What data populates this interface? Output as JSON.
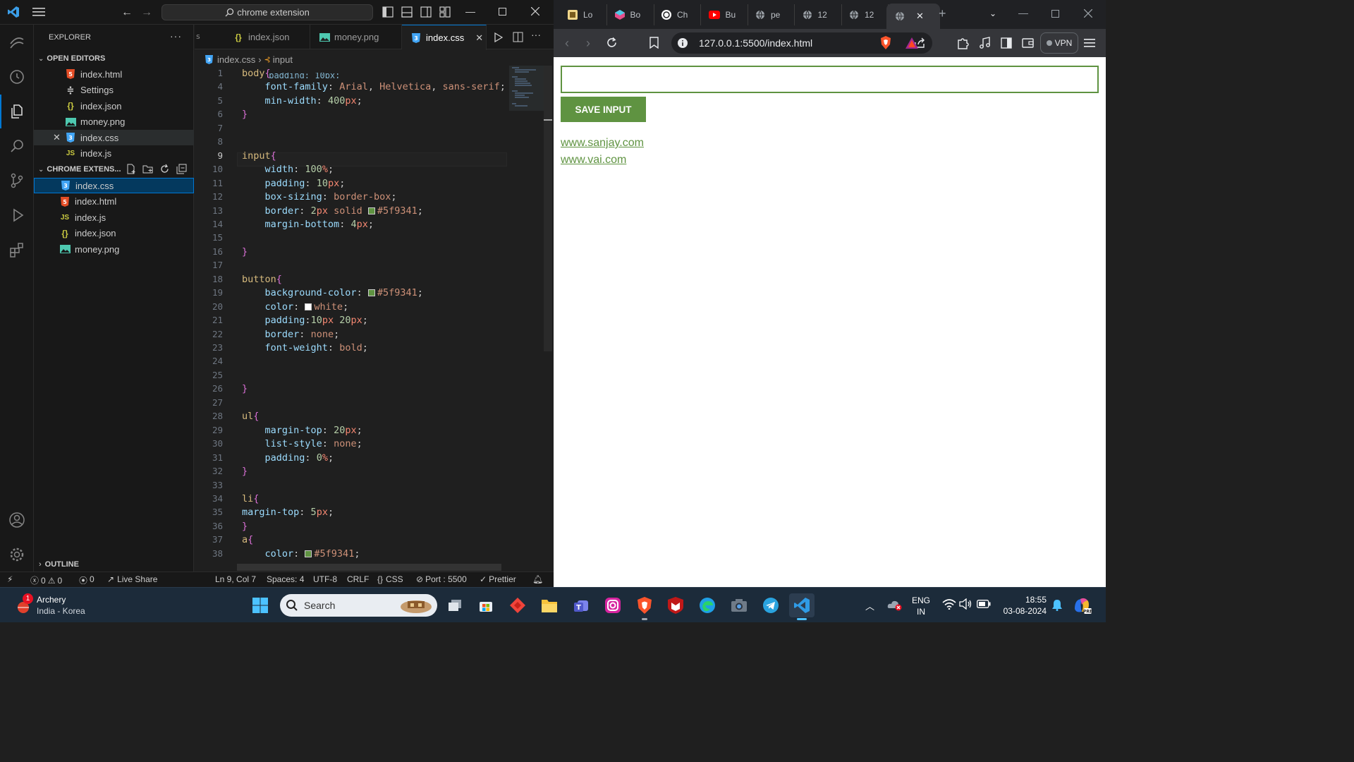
{
  "vscode": {
    "search_text": "chrome extension",
    "explorer_title": "EXPLORER",
    "open_editors_title": "OPEN EDITORS",
    "open_editors": [
      {
        "name": "index.html",
        "icon": "html-icon"
      },
      {
        "name": "Settings",
        "icon": "settings-icon"
      },
      {
        "name": "index.json",
        "icon": "json-icon"
      },
      {
        "name": "money.png",
        "icon": "image-icon"
      },
      {
        "name": "index.css",
        "icon": "css-icon"
      },
      {
        "name": "index.js",
        "icon": "js-icon"
      }
    ],
    "folder_title": "CHROME EXTENS...",
    "folder_files": [
      {
        "name": "index.css",
        "icon": "css-icon"
      },
      {
        "name": "index.html",
        "icon": "html-icon"
      },
      {
        "name": "index.js",
        "icon": "js-icon"
      },
      {
        "name": "index.json",
        "icon": "json-icon"
      },
      {
        "name": "money.png",
        "icon": "image-icon"
      }
    ],
    "outline_title": "OUTLINE",
    "tabs": [
      {
        "label": "index.json"
      },
      {
        "label": "money.png"
      },
      {
        "label": "index.css",
        "active": true
      }
    ],
    "breadcrumb": {
      "file": "index.css",
      "symbol": "input"
    },
    "code_lines": [
      {
        "n": "1",
        "text": "body{"
      },
      {
        "n": "4",
        "text": "    font-family: Arial, Helvetica, sans-serif;"
      },
      {
        "n": "5",
        "text": "    min-width: 400px;"
      },
      {
        "n": "6",
        "text": "}"
      },
      {
        "n": "7",
        "text": ""
      },
      {
        "n": "8",
        "text": ""
      },
      {
        "n": "9",
        "text": "input{"
      },
      {
        "n": "10",
        "text": "    width: 100%;"
      },
      {
        "n": "11",
        "text": "    padding: 10px;"
      },
      {
        "n": "12",
        "text": "    box-sizing: border-box;"
      },
      {
        "n": "13",
        "text": "    border: 2px solid #5f9341;"
      },
      {
        "n": "14",
        "text": "    margin-bottom: 4px;"
      },
      {
        "n": "15",
        "text": ""
      },
      {
        "n": "16",
        "text": "}"
      },
      {
        "n": "17",
        "text": ""
      },
      {
        "n": "18",
        "text": "button{"
      },
      {
        "n": "19",
        "text": "    background-color: #5f9341;"
      },
      {
        "n": "20",
        "text": "    color: white;"
      },
      {
        "n": "21",
        "text": "    padding:10px 20px;"
      },
      {
        "n": "22",
        "text": "    border: none;"
      },
      {
        "n": "23",
        "text": "    font-weight: bold;"
      },
      {
        "n": "24",
        "text": ""
      },
      {
        "n": "25",
        "text": ""
      },
      {
        "n": "26",
        "text": "}"
      },
      {
        "n": "27",
        "text": ""
      },
      {
        "n": "28",
        "text": "ul{"
      },
      {
        "n": "29",
        "text": "    margin-top: 20px;"
      },
      {
        "n": "30",
        "text": "    list-style: none;"
      },
      {
        "n": "31",
        "text": "    padding: 0%;"
      },
      {
        "n": "32",
        "text": "}"
      },
      {
        "n": "33",
        "text": ""
      },
      {
        "n": "34",
        "text": "li{"
      },
      {
        "n": "35",
        "text": "margin-top: 5px;"
      },
      {
        "n": "36",
        "text": "}"
      },
      {
        "n": "37",
        "text": "a{"
      },
      {
        "n": "38",
        "text": "    color: #5f9341;"
      }
    ],
    "status": {
      "errors": "0",
      "warnings": "0",
      "ports": "0",
      "live_share": "Live Share",
      "position": "Ln 9, Col 7",
      "spaces": "Spaces: 4",
      "encoding": "UTF-8",
      "eol": "CRLF",
      "language": "CSS",
      "port": "Port : 5500",
      "prettier": "Prettier"
    }
  },
  "browser": {
    "tabs": [
      "Lo",
      "Bo",
      "Ch",
      "Bu",
      "pe",
      "12",
      "12"
    ],
    "url": "127.0.0.1:5500/index.html",
    "vpn": "VPN",
    "page": {
      "input_value": "",
      "button_label": "SAVE INPUT",
      "links": [
        "www.sanjay.com",
        "www.vai.com"
      ],
      "accent": "#5f9341"
    }
  },
  "taskbar": {
    "weather_title": "Archery",
    "weather_sub": "India - Korea",
    "badge": "1",
    "search_placeholder": "Search",
    "lang_line1": "ENG",
    "lang_line2": "IN",
    "time": "18:55",
    "date": "03-08-2024"
  }
}
